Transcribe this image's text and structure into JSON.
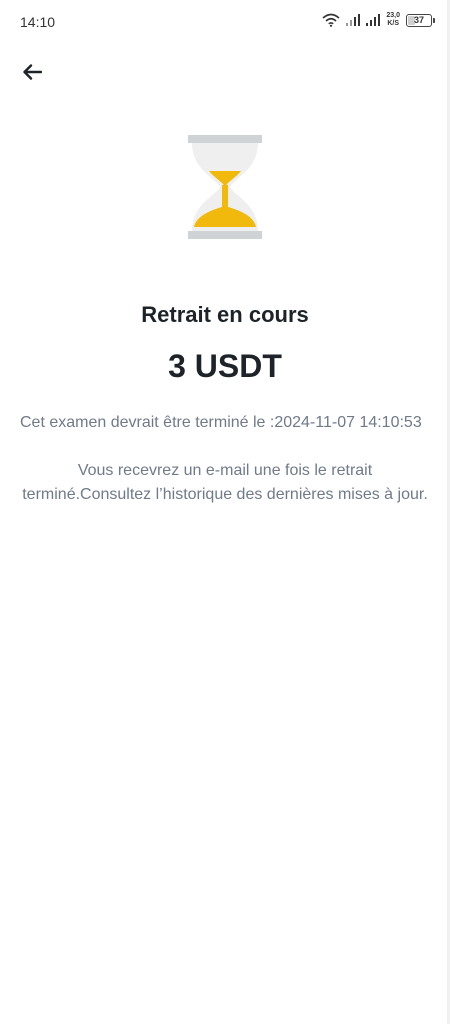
{
  "status_bar": {
    "time": "14:10",
    "net_speed_value": "23,0",
    "net_speed_unit": "K/S",
    "battery_level": "37"
  },
  "header": {
    "back_icon": "arrow-left-icon"
  },
  "hourglass": {
    "icon": "hourglass-icon",
    "accent_color": "#f0b90b",
    "frame_color": "#d0d3d6",
    "glass_color": "#efefef"
  },
  "withdrawal": {
    "title": "Retrait en cours",
    "amount": "3 USDT",
    "eta_text": "Cet examen devrait être terminé le :2024-11-07 14:10:53",
    "notice_text": "Vous recevrez un e-mail une fois le retrait terminé.Consultez l’historique des dernières mises à jour."
  }
}
